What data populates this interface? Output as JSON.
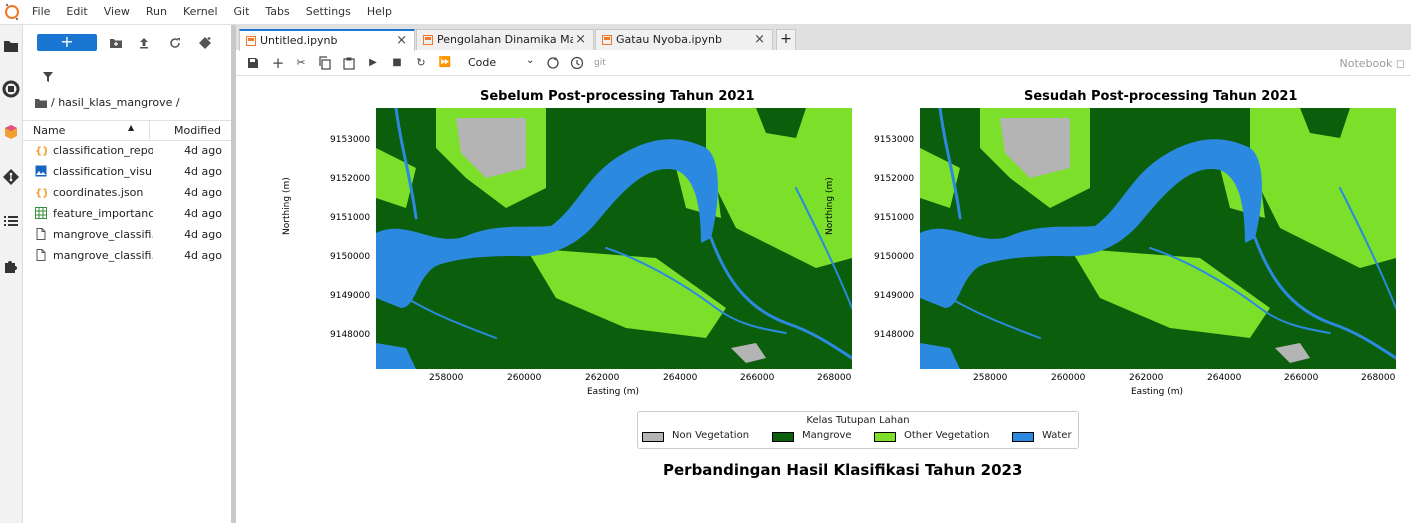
{
  "menubar": {
    "items": [
      "File",
      "Edit",
      "View",
      "Run",
      "Kernel",
      "Git",
      "Tabs",
      "Settings",
      "Help"
    ]
  },
  "sidebar": {
    "new_label": "+",
    "breadcrumb": "/ hasil_klas_mangrove /",
    "col_name": "Name",
    "col_modified": "Modified",
    "files": [
      {
        "name": "classification_repo...",
        "modified": "4d ago",
        "icon": "json-icon"
      },
      {
        "name": "classification_visu...",
        "modified": "4d ago",
        "icon": "image-icon"
      },
      {
        "name": "coordinates.json",
        "modified": "4d ago",
        "icon": "json-icon"
      },
      {
        "name": "feature_importanc...",
        "modified": "4d ago",
        "icon": "csv-icon"
      },
      {
        "name": "mangrove_classifi...",
        "modified": "4d ago",
        "icon": "file-icon"
      },
      {
        "name": "mangrove_classifi...",
        "modified": "4d ago",
        "icon": "file-icon"
      }
    ]
  },
  "tabs": [
    {
      "label": "Untitled.ipynb",
      "active": true
    },
    {
      "label": "Pengolahan Dinamika Mangr",
      "active": false
    },
    {
      "label": "Gatau Nyoba.ipynb",
      "active": false
    }
  ],
  "toolbar": {
    "cell_type": "Code",
    "git_label": "git",
    "notebook_label": "Notebook"
  },
  "figure": {
    "left_title": "Sebelum Post-processing Tahun 2021",
    "right_title": "Sesudah Post-processing Tahun 2021",
    "xlabel": "Easting (m)",
    "ylabel": "Northing (m)",
    "xticks": [
      "258000",
      "260000",
      "262000",
      "264000",
      "266000",
      "268000"
    ],
    "yticks": [
      "9153000",
      "9152000",
      "9151000",
      "9150000",
      "9149000",
      "9148000"
    ],
    "legend_title": "Kelas Tutupan Lahan",
    "legend": [
      {
        "label": "Non Vegetation",
        "color": "#b4b4b4"
      },
      {
        "label": "Mangrove",
        "color": "#0b5e0b"
      },
      {
        "label": "Other Vegetation",
        "color": "#7ce02a"
      },
      {
        "label": "Water",
        "color": "#2b8ae0"
      }
    ],
    "suptitle": "Perbandingan Hasil Klasifikasi Tahun 2023"
  }
}
